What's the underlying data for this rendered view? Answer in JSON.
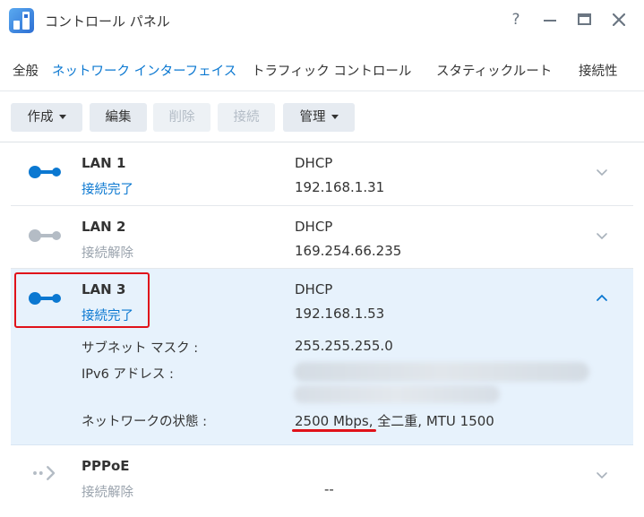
{
  "window": {
    "title": "コントロール パネル",
    "help_label": "?"
  },
  "tabs": [
    {
      "label": "全般",
      "active": false
    },
    {
      "label": "ネットワーク インターフェイス",
      "active": true
    },
    {
      "label": "トラフィック コントロール",
      "active": false
    },
    {
      "label": "スタティックルート",
      "active": false
    },
    {
      "label": "接続性",
      "active": false
    }
  ],
  "toolbar": {
    "create_label": "作成",
    "edit_label": "編集",
    "delete_label": "削除",
    "connect_label": "接続",
    "manage_label": "管理"
  },
  "interfaces": [
    {
      "name": "LAN 1",
      "status": "接続完了",
      "mode": "DHCP",
      "ip": "192.168.1.31",
      "connected": true,
      "expanded": false
    },
    {
      "name": "LAN 2",
      "status": "接続解除",
      "mode": "DHCP",
      "ip": "169.254.66.235",
      "connected": false,
      "expanded": false
    },
    {
      "name": "LAN 3",
      "status": "接続完了",
      "mode": "DHCP",
      "ip": "192.168.1.53",
      "connected": true,
      "expanded": true,
      "details": {
        "subnet_label": "サブネット マスク :",
        "subnet_value": "255.255.255.0",
        "ipv6_label": "IPv6 アドレス :",
        "state_label": "ネットワークの状態 :",
        "state_value": "2500 Mbps, 全二重, MTU 1500"
      }
    },
    {
      "name": "PPPoE",
      "status": "接続解除",
      "mode": "--",
      "connected": false,
      "expanded": false
    }
  ],
  "colors": {
    "accent": "#0b78d1",
    "disconnected": "#9aa3ad",
    "selected_row": "#e7f2fc",
    "annotation_red": "#e0121a"
  }
}
